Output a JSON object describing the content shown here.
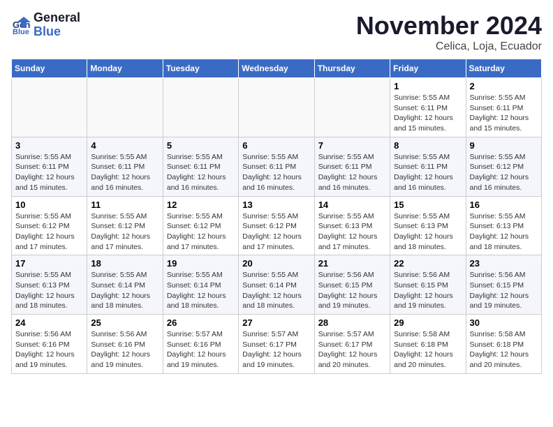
{
  "header": {
    "logo_line1": "General",
    "logo_line2": "Blue",
    "month": "November 2024",
    "location": "Celica, Loja, Ecuador"
  },
  "days_of_week": [
    "Sunday",
    "Monday",
    "Tuesday",
    "Wednesday",
    "Thursday",
    "Friday",
    "Saturday"
  ],
  "weeks": [
    [
      {
        "day": "",
        "info": ""
      },
      {
        "day": "",
        "info": ""
      },
      {
        "day": "",
        "info": ""
      },
      {
        "day": "",
        "info": ""
      },
      {
        "day": "",
        "info": ""
      },
      {
        "day": "1",
        "info": "Sunrise: 5:55 AM\nSunset: 6:11 PM\nDaylight: 12 hours\nand 15 minutes."
      },
      {
        "day": "2",
        "info": "Sunrise: 5:55 AM\nSunset: 6:11 PM\nDaylight: 12 hours\nand 15 minutes."
      }
    ],
    [
      {
        "day": "3",
        "info": "Sunrise: 5:55 AM\nSunset: 6:11 PM\nDaylight: 12 hours\nand 15 minutes."
      },
      {
        "day": "4",
        "info": "Sunrise: 5:55 AM\nSunset: 6:11 PM\nDaylight: 12 hours\nand 16 minutes."
      },
      {
        "day": "5",
        "info": "Sunrise: 5:55 AM\nSunset: 6:11 PM\nDaylight: 12 hours\nand 16 minutes."
      },
      {
        "day": "6",
        "info": "Sunrise: 5:55 AM\nSunset: 6:11 PM\nDaylight: 12 hours\nand 16 minutes."
      },
      {
        "day": "7",
        "info": "Sunrise: 5:55 AM\nSunset: 6:11 PM\nDaylight: 12 hours\nand 16 minutes."
      },
      {
        "day": "8",
        "info": "Sunrise: 5:55 AM\nSunset: 6:11 PM\nDaylight: 12 hours\nand 16 minutes."
      },
      {
        "day": "9",
        "info": "Sunrise: 5:55 AM\nSunset: 6:12 PM\nDaylight: 12 hours\nand 16 minutes."
      }
    ],
    [
      {
        "day": "10",
        "info": "Sunrise: 5:55 AM\nSunset: 6:12 PM\nDaylight: 12 hours\nand 17 minutes."
      },
      {
        "day": "11",
        "info": "Sunrise: 5:55 AM\nSunset: 6:12 PM\nDaylight: 12 hours\nand 17 minutes."
      },
      {
        "day": "12",
        "info": "Sunrise: 5:55 AM\nSunset: 6:12 PM\nDaylight: 12 hours\nand 17 minutes."
      },
      {
        "day": "13",
        "info": "Sunrise: 5:55 AM\nSunset: 6:12 PM\nDaylight: 12 hours\nand 17 minutes."
      },
      {
        "day": "14",
        "info": "Sunrise: 5:55 AM\nSunset: 6:13 PM\nDaylight: 12 hours\nand 17 minutes."
      },
      {
        "day": "15",
        "info": "Sunrise: 5:55 AM\nSunset: 6:13 PM\nDaylight: 12 hours\nand 18 minutes."
      },
      {
        "day": "16",
        "info": "Sunrise: 5:55 AM\nSunset: 6:13 PM\nDaylight: 12 hours\nand 18 minutes."
      }
    ],
    [
      {
        "day": "17",
        "info": "Sunrise: 5:55 AM\nSunset: 6:13 PM\nDaylight: 12 hours\nand 18 minutes."
      },
      {
        "day": "18",
        "info": "Sunrise: 5:55 AM\nSunset: 6:14 PM\nDaylight: 12 hours\nand 18 minutes."
      },
      {
        "day": "19",
        "info": "Sunrise: 5:55 AM\nSunset: 6:14 PM\nDaylight: 12 hours\nand 18 minutes."
      },
      {
        "day": "20",
        "info": "Sunrise: 5:55 AM\nSunset: 6:14 PM\nDaylight: 12 hours\nand 18 minutes."
      },
      {
        "day": "21",
        "info": "Sunrise: 5:56 AM\nSunset: 6:15 PM\nDaylight: 12 hours\nand 19 minutes."
      },
      {
        "day": "22",
        "info": "Sunrise: 5:56 AM\nSunset: 6:15 PM\nDaylight: 12 hours\nand 19 minutes."
      },
      {
        "day": "23",
        "info": "Sunrise: 5:56 AM\nSunset: 6:15 PM\nDaylight: 12 hours\nand 19 minutes."
      }
    ],
    [
      {
        "day": "24",
        "info": "Sunrise: 5:56 AM\nSunset: 6:16 PM\nDaylight: 12 hours\nand 19 minutes."
      },
      {
        "day": "25",
        "info": "Sunrise: 5:56 AM\nSunset: 6:16 PM\nDaylight: 12 hours\nand 19 minutes."
      },
      {
        "day": "26",
        "info": "Sunrise: 5:57 AM\nSunset: 6:16 PM\nDaylight: 12 hours\nand 19 minutes."
      },
      {
        "day": "27",
        "info": "Sunrise: 5:57 AM\nSunset: 6:17 PM\nDaylight: 12 hours\nand 19 minutes."
      },
      {
        "day": "28",
        "info": "Sunrise: 5:57 AM\nSunset: 6:17 PM\nDaylight: 12 hours\nand 20 minutes."
      },
      {
        "day": "29",
        "info": "Sunrise: 5:58 AM\nSunset: 6:18 PM\nDaylight: 12 hours\nand 20 minutes."
      },
      {
        "day": "30",
        "info": "Sunrise: 5:58 AM\nSunset: 6:18 PM\nDaylight: 12 hours\nand 20 minutes."
      }
    ]
  ]
}
